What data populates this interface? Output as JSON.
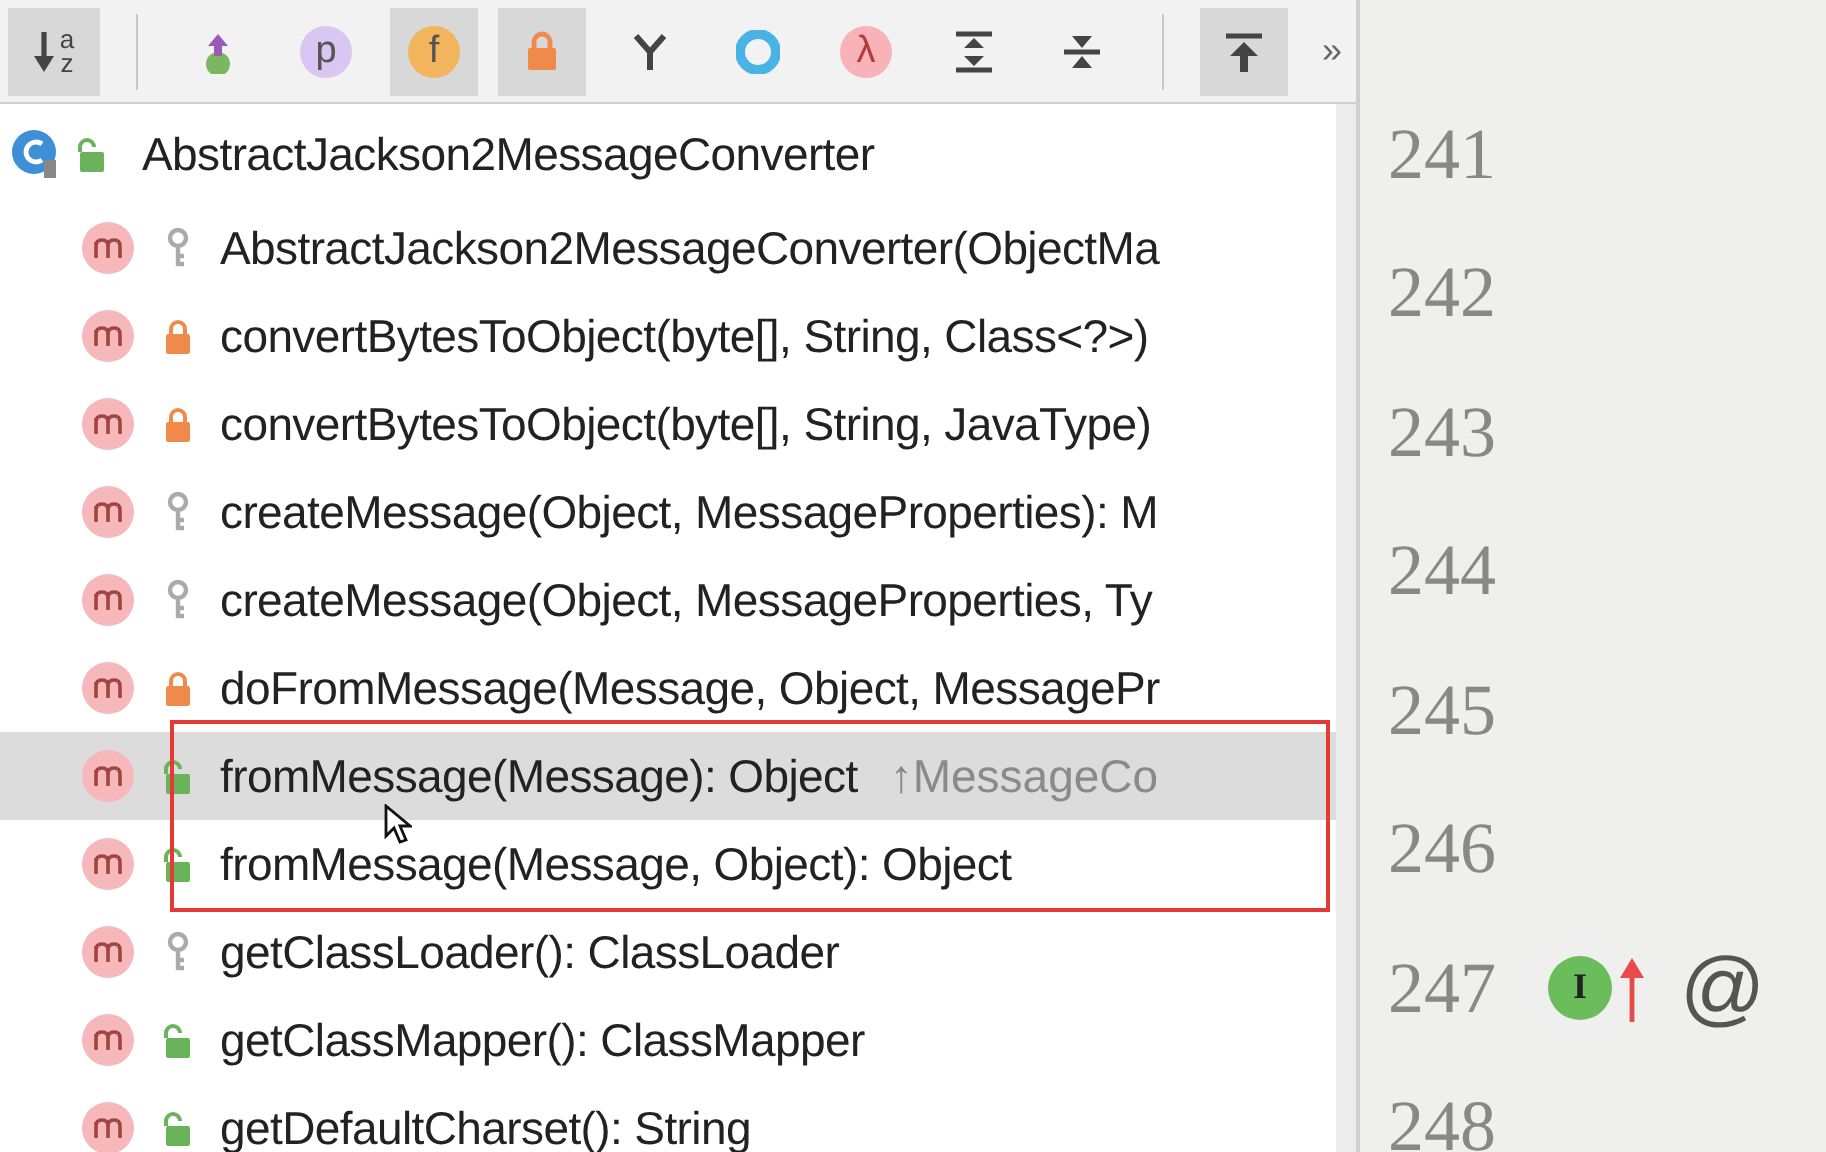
{
  "toolbar": {
    "buttons": [
      {
        "kind": "sort",
        "label": "az",
        "on": true
      },
      {
        "kind": "separator"
      },
      {
        "kind": "inherited",
        "on": false
      },
      {
        "kind": "property",
        "label": "p",
        "on": false
      },
      {
        "kind": "field",
        "label": "f",
        "on": true
      },
      {
        "kind": "lock",
        "on": true
      },
      {
        "kind": "fork",
        "on": false
      },
      {
        "kind": "ring",
        "on": false
      },
      {
        "kind": "lambda",
        "label": "λ",
        "on": false
      },
      {
        "kind": "expand",
        "on": false
      },
      {
        "kind": "collapse",
        "on": false
      },
      {
        "kind": "separator"
      },
      {
        "kind": "autoscroll",
        "on": true
      },
      {
        "kind": "more",
        "label": "»",
        "on": false
      }
    ]
  },
  "tree": {
    "name": "AbstractJackson2MessageConverter",
    "kind": "public-class",
    "children": [
      {
        "name": "AbstractJackson2MessageConverter(ObjectMa",
        "kind": "protected-method",
        "selected": false,
        "boxed": false
      },
      {
        "name": "convertBytesToObject(byte[], String, Class<?>)",
        "kind": "private-method",
        "selected": false,
        "boxed": false
      },
      {
        "name": "convertBytesToObject(byte[], String, JavaType)",
        "kind": "private-method",
        "selected": false,
        "boxed": false
      },
      {
        "name": "createMessage(Object, MessageProperties): M",
        "kind": "protected-method",
        "selected": false,
        "boxed": false
      },
      {
        "name": "createMessage(Object, MessageProperties, Ty",
        "kind": "protected-method",
        "selected": false,
        "boxed": false
      },
      {
        "name": "doFromMessage(Message, Object, MessagePr",
        "kind": "private-method",
        "selected": false,
        "boxed": false
      },
      {
        "name": "fromMessage(Message): Object",
        "inherited_from": "↑MessageCo",
        "kind": "public-method",
        "selected": true,
        "boxed": true
      },
      {
        "name": "fromMessage(Message, Object): Object",
        "kind": "public-method",
        "selected": false,
        "boxed": true
      },
      {
        "name": "getClassLoader(): ClassLoader",
        "kind": "protected-method",
        "selected": false,
        "boxed": false
      },
      {
        "name": "getClassMapper(): ClassMapper",
        "kind": "public-method",
        "selected": false,
        "boxed": false
      },
      {
        "name": "getDefaultCharset(): String",
        "kind": "public-method",
        "selected": false,
        "boxed": false
      }
    ]
  },
  "gutter": {
    "lines": [
      {
        "number": "241"
      },
      {
        "number": "242"
      },
      {
        "number": "243"
      },
      {
        "number": "244"
      },
      {
        "number": "245"
      },
      {
        "number": "246"
      },
      {
        "number": "247",
        "marks": [
          {
            "kind": "implements",
            "label": "I"
          },
          {
            "kind": "annotation",
            "label": "@"
          }
        ]
      },
      {
        "number": "248"
      }
    ]
  }
}
